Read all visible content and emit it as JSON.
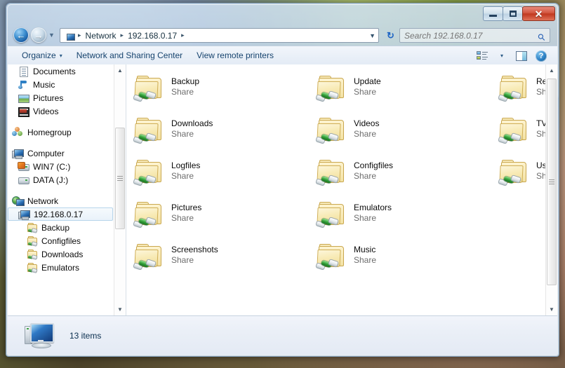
{
  "window": {
    "controls": {
      "minimize_label": "–",
      "maximize_label": "",
      "close_label": "✕"
    }
  },
  "address": {
    "back_glyph": "←",
    "forward_glyph": "→",
    "recent_glyph": "▼",
    "crumbs": [
      "Network",
      "192.168.0.17"
    ],
    "separator": "▸",
    "dropdown_glyph": "▼",
    "refresh_glyph": "↻"
  },
  "search": {
    "placeholder": "Search 192.168.0.17",
    "value": "",
    "icon_glyph": "⚲"
  },
  "commandbar": {
    "organize_label": "Organize",
    "organize_caret": "▾",
    "network_sharing_label": "Network and Sharing Center",
    "view_remote_printers_label": "View remote printers",
    "view_caret": "▾",
    "help_label": "?"
  },
  "navpane": {
    "scroll": {
      "up_glyph": "▲",
      "down_glyph": "▼"
    },
    "items": [
      {
        "label": "Documents",
        "icon": "document-icon",
        "indent": 1
      },
      {
        "label": "Music",
        "icon": "music-icon",
        "indent": 1
      },
      {
        "label": "Pictures",
        "icon": "pictures-icon",
        "indent": 1
      },
      {
        "label": "Videos",
        "icon": "videos-icon",
        "indent": 1
      },
      {
        "label": "Homegroup",
        "icon": "homegroup-icon",
        "indent": 0,
        "spacer_before": true
      },
      {
        "label": "Computer",
        "icon": "computer-icon",
        "indent": 0,
        "spacer_before": true
      },
      {
        "label": "WIN7 (C:)",
        "icon": "harddrive-icon",
        "indent": 1
      },
      {
        "label": "DATA (J:)",
        "icon": "drive-icon",
        "indent": 1
      },
      {
        "label": "Network",
        "icon": "network-icon",
        "indent": 0,
        "spacer_before": true
      },
      {
        "label": "192.168.0.17",
        "icon": "computer-icon",
        "indent": 1,
        "selected": true
      },
      {
        "label": "Backup",
        "icon": "shared-folder-icon",
        "indent": 2
      },
      {
        "label": "Configfiles",
        "icon": "shared-folder-icon",
        "indent": 2
      },
      {
        "label": "Downloads",
        "icon": "shared-folder-icon",
        "indent": 2
      },
      {
        "label": "Emulators",
        "icon": "shared-folder-icon",
        "indent": 2
      }
    ]
  },
  "content": {
    "scroll": {
      "up_glyph": "▲",
      "down_glyph": "▼"
    },
    "items": [
      {
        "name": "Backup",
        "type": "Share"
      },
      {
        "name": "Downloads",
        "type": "Share"
      },
      {
        "name": "Logfiles",
        "type": "Share"
      },
      {
        "name": "Pictures",
        "type": "Share"
      },
      {
        "name": "Screenshots",
        "type": "Share"
      },
      {
        "name": "Update",
        "type": "Share"
      },
      {
        "name": "Videos",
        "type": "Share"
      },
      {
        "name": "Configfiles",
        "type": "Share"
      },
      {
        "name": "Emulators",
        "type": "Share"
      },
      {
        "name": "Music",
        "type": "Share"
      },
      {
        "name": "Recordings",
        "type": "Share"
      },
      {
        "name": "TV Shows",
        "type": "Share"
      },
      {
        "name": "Userdata",
        "type": "Share"
      }
    ]
  },
  "statusbar": {
    "item_count_label": "13 items"
  },
  "colors": {
    "accent": "#2a62b5",
    "folder": "#f0dd98",
    "share_green": "#2f9c35",
    "close_red": "#c0381f",
    "text": "#0b0b0b",
    "subtext": "#6d6d6d"
  }
}
